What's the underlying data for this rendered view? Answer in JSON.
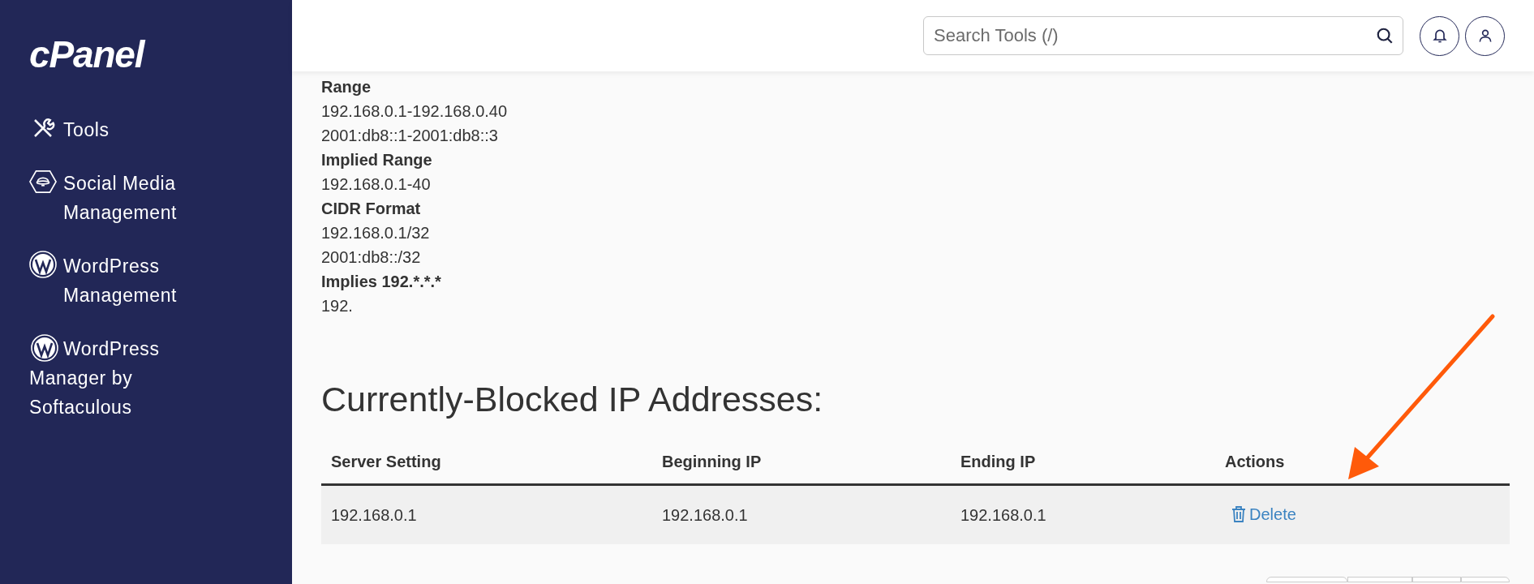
{
  "sidebar": {
    "logo": "cPanel",
    "items": [
      {
        "label": "Tools",
        "kind": "tools"
      },
      {
        "label": "Social Media Management",
        "kind": "social"
      },
      {
        "label": "WordPress Management",
        "kind": "wordpress"
      },
      {
        "label": "WordPress Manager by Softaculous",
        "kind": "wordpress-wrap"
      }
    ]
  },
  "header": {
    "search": {
      "placeholder": "Search Tools (/)"
    }
  },
  "examples": [
    {
      "kind": "heading",
      "text": "Range"
    },
    {
      "kind": "line",
      "text": "192.168.0.1-192.168.0.40"
    },
    {
      "kind": "line",
      "text": "2001:db8::1-2001:db8::3"
    },
    {
      "kind": "heading",
      "text": "Implied Range"
    },
    {
      "kind": "line",
      "text": "192.168.0.1-40"
    },
    {
      "kind": "heading",
      "text": "CIDR Format"
    },
    {
      "kind": "line",
      "text": "192.168.0.1/32"
    },
    {
      "kind": "line",
      "text": "2001:db8::/32"
    },
    {
      "kind": "heading",
      "text": "Implies 192.*.*.*"
    },
    {
      "kind": "line",
      "text": "192."
    }
  ],
  "blocked": {
    "title": "Currently-Blocked IP Addresses:",
    "columns": [
      "Server Setting",
      "Beginning IP",
      "Ending IP",
      "Actions"
    ],
    "rows": [
      {
        "server_setting": "192.168.0.1",
        "beginning_ip": "192.168.0.1",
        "ending_ip": "192.168.0.1",
        "action": "Delete"
      }
    ]
  }
}
